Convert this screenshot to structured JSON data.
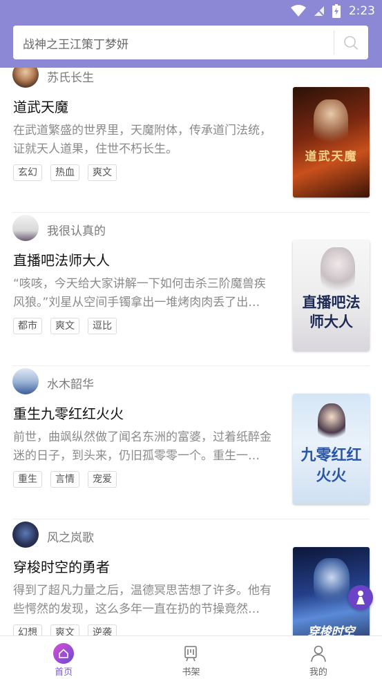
{
  "status_bar": {
    "time": "2:23"
  },
  "search": {
    "text": "战神之王江策丁梦妍"
  },
  "books": [
    {
      "author": "苏氏长生",
      "title": "道武天魔",
      "desc": "在武道繁盛的世界里，天魔附体，传承道门法统，证就天人道果，住世不朽长生。",
      "tags": [
        "玄幻",
        "热血",
        "爽文"
      ],
      "cover_text": "道武天魔"
    },
    {
      "author": "我很认真的",
      "title": "直播吧法师大人",
      "desc": "“咳咳，今天给大家讲解一下如何击杀三阶魔兽疾风狼。”刘星从空间手镯拿出一堆烤肉肉丢了出…",
      "tags": [
        "都市",
        "爽文",
        "逗比"
      ],
      "cover_text": "直播吧法师大人"
    },
    {
      "author": "水木韶华",
      "title": "重生九零红红火火",
      "desc": "前世，曲飒纵然做了闻名东洲的富婆，过着纸醉金迷的日子，到头来，仍旧孤零零一个。重生一…",
      "tags": [
        "重生",
        "言情",
        "宠爱"
      ],
      "cover_text": "九零红红火火"
    },
    {
      "author": "风之岚歌",
      "title": "穿梭时空的勇者",
      "desc": "得到了超凡力量之后，温德冥思苦想了许多。他有些愕然的发现，这么多年一直在扔的节操竟然…",
      "tags": [
        "幻想",
        "爽文",
        "逆袭"
      ],
      "cover_text": "穿梭时空"
    }
  ],
  "bottom_nav": [
    {
      "label": "首页",
      "icon": "home-icon",
      "active": true
    },
    {
      "label": "书架",
      "icon": "bookshelf-icon",
      "active": false
    },
    {
      "label": "我的",
      "icon": "profile-icon",
      "active": false
    }
  ],
  "colors": {
    "header": "#8c88d6",
    "accent": "#7c5cd6"
  }
}
